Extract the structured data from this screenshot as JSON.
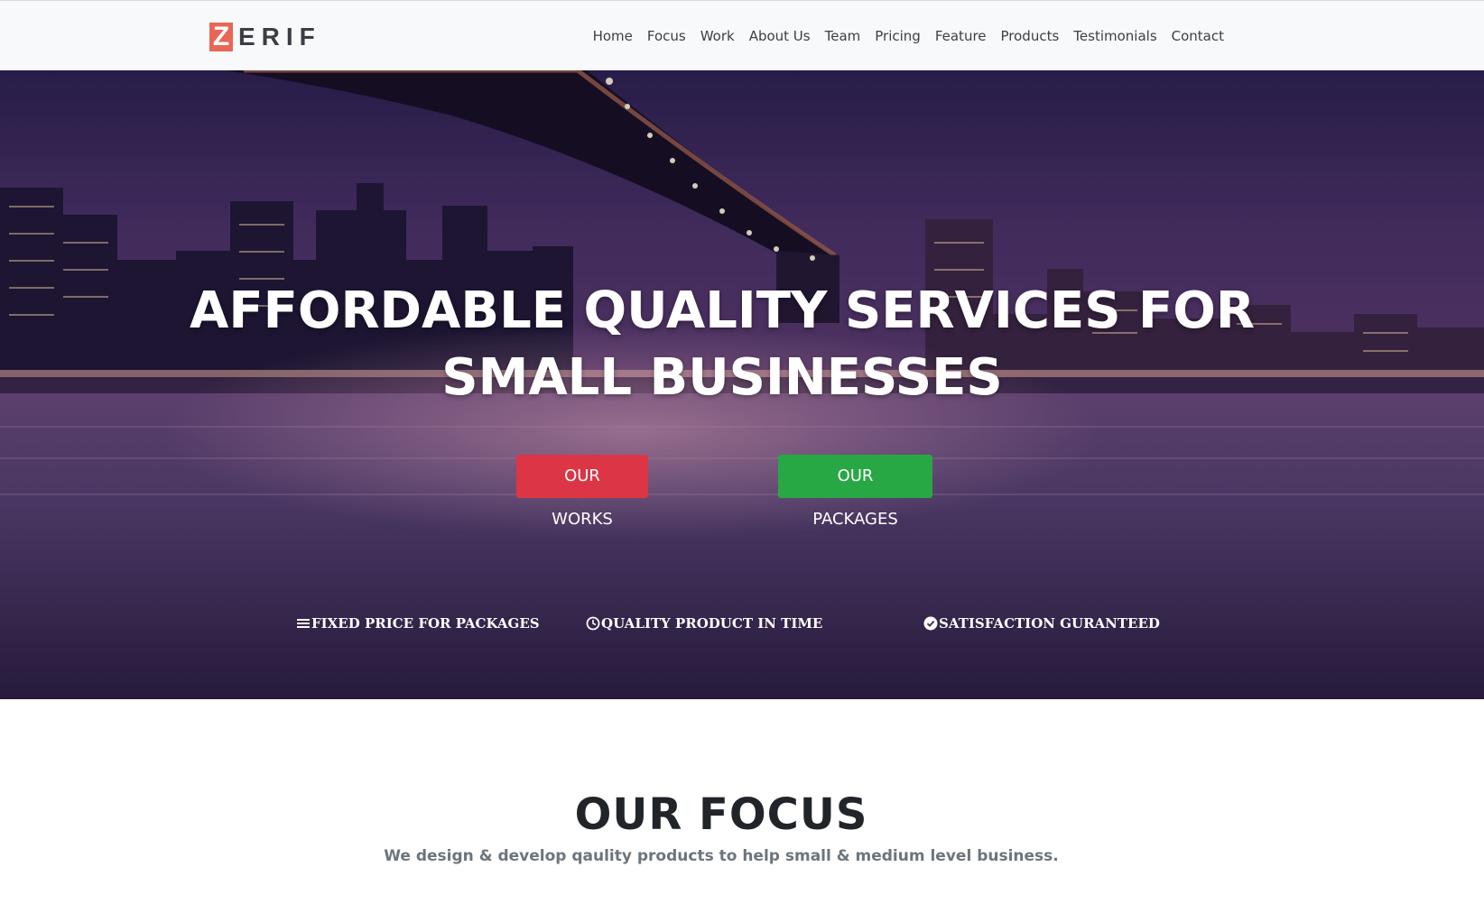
{
  "brand": {
    "logo_letter": "Z",
    "logo_rest": "ERIF",
    "accent_color": "#e96656"
  },
  "nav": {
    "items": [
      {
        "label": "Home"
      },
      {
        "label": "Focus"
      },
      {
        "label": "Work"
      },
      {
        "label": "About Us"
      },
      {
        "label": "Team"
      },
      {
        "label": "Pricing"
      },
      {
        "label": "Feature"
      },
      {
        "label": "Products"
      },
      {
        "label": "Testimonials"
      },
      {
        "label": "Contact"
      }
    ]
  },
  "hero": {
    "title_line1": "AFFORDABLE QUALITY SERVICES FOR",
    "title_line2": "SMALL BUSINESSES",
    "buttons": {
      "works_label": "OUR WORKS",
      "works_color": "#dc3545",
      "packages_label": "OUR PACKAGES",
      "packages_color": "#28a745"
    },
    "features": [
      {
        "icon": "bars-icon",
        "label": "FIXED PRICE FOR PACKAGES"
      },
      {
        "icon": "clock-icon",
        "label": "QUALITY PRODUCT IN TIME"
      },
      {
        "icon": "check-circle-icon",
        "label": "SATISFACTION GURANTEED"
      }
    ]
  },
  "focus": {
    "title": "OUR FOCUS",
    "subtitle": "We design & develop qaulity products to help small & medium level business."
  }
}
